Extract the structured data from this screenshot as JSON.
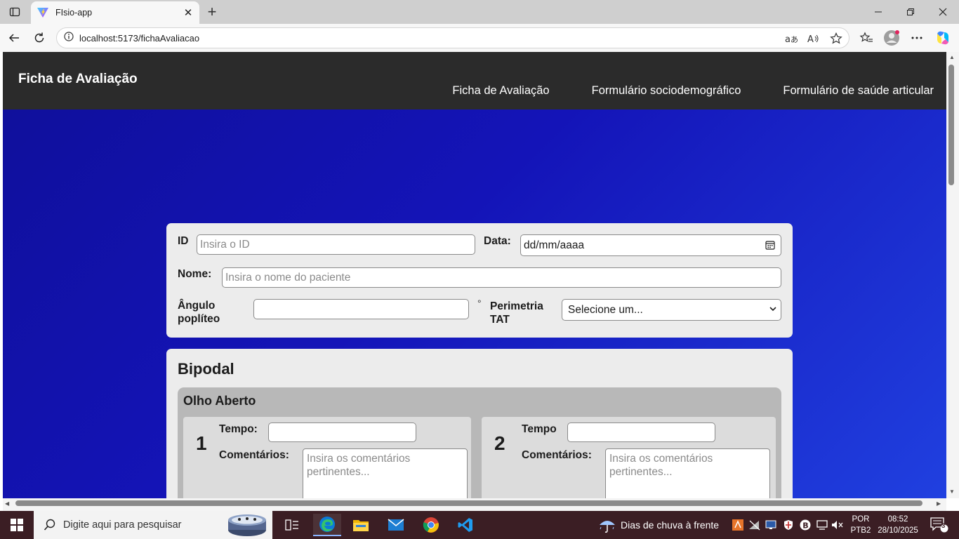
{
  "browser": {
    "tab_title": "FIsio-app",
    "url": "localhost:5173/fichaAvaliacao"
  },
  "header": {
    "brand": "Ficha de Avaliação",
    "nav": [
      "Ficha de Avaliação",
      "Formulário sociodemográfico",
      "Formulário de saúde articular"
    ]
  },
  "form": {
    "id_label": "ID",
    "id_placeholder": "Insira o ID",
    "date_label": "Data:",
    "date_value": "dd/mm/aaaa",
    "name_label": "Nome:",
    "name_placeholder": "Insira o nome do paciente",
    "angle_label_1": "Ângulo",
    "angle_label_2": "poplíteo",
    "angle_unit": "°",
    "perimetria_label_1": "Perimetria",
    "perimetria_label_2": "TAT",
    "perimetria_value": "Selecione um..."
  },
  "bipodal": {
    "title": "Bipodal",
    "section": "Olho Aberto",
    "trials": [
      {
        "number": "1",
        "tempo_label": "Tempo:",
        "comments_label": "Comentários:",
        "comments_placeholder": "Insira os comentários pertinentes..."
      },
      {
        "number": "2",
        "tempo_label": "Tempo",
        "comments_label": "Comentários:",
        "comments_placeholder": "Insira os comentários pertinentes..."
      }
    ]
  },
  "taskbar": {
    "search_placeholder": "Digite aqui para pesquisar",
    "weather": "Dias de chuva à frente",
    "lang_1": "POR",
    "lang_2": "PTB2",
    "time": "08:52",
    "date": "28/10/2025",
    "notifications": "3"
  },
  "colors": {
    "header_bg": "#2b2b2b",
    "page_gradient_start": "#0f0f99",
    "page_gradient_end": "#2040e0",
    "card_bg": "#ececec",
    "subcard_bg": "#b8b8b8"
  }
}
